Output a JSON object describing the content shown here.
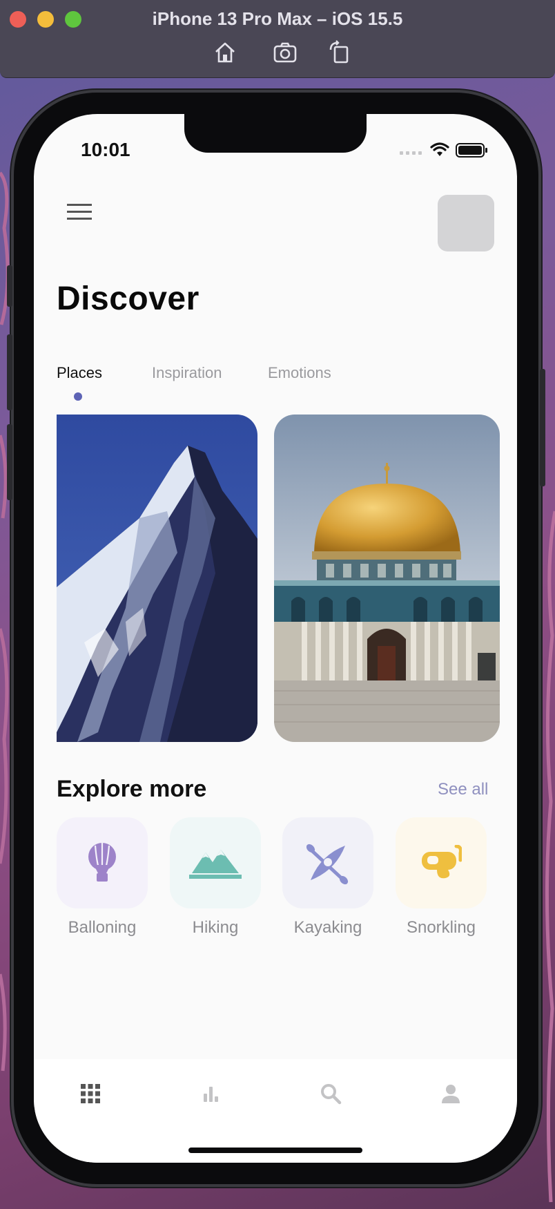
{
  "simulator": {
    "title": "iPhone 13 Pro Max – iOS 15.5",
    "tools": [
      "home-icon",
      "screenshot-icon",
      "rotate-icon"
    ]
  },
  "status_bar": {
    "time": "10:01"
  },
  "header": {
    "title": "Discover",
    "menu_icon": "hamburger-menu-icon"
  },
  "tabs": [
    {
      "label": "Places",
      "active": true
    },
    {
      "label": "Inspiration",
      "active": false
    },
    {
      "label": "Emotions",
      "active": false
    }
  ],
  "explore": {
    "title": "Explore more",
    "see_all": "See all",
    "categories": [
      {
        "label": "Balloning",
        "icon": "hot-air-balloon-icon",
        "color": "#9d83c9",
        "bg": "#f4f1fa"
      },
      {
        "label": "Hiking",
        "icon": "mountains-icon",
        "color": "#6cbdb1",
        "bg": "#eff7f7"
      },
      {
        "label": "Kayaking",
        "icon": "kayak-icon",
        "color": "#8a8fcf",
        "bg": "#f1f1f8"
      },
      {
        "label": "Snorkling",
        "icon": "snorkel-mask-icon",
        "color": "#efbf3f",
        "bg": "#fdf8ec"
      }
    ]
  },
  "tab_bar": {
    "items": [
      "grid-icon",
      "bar-chart-icon",
      "search-icon",
      "profile-icon"
    ]
  },
  "colors": {
    "accent": "#5d63b5",
    "see_all": "#8f90bf"
  }
}
